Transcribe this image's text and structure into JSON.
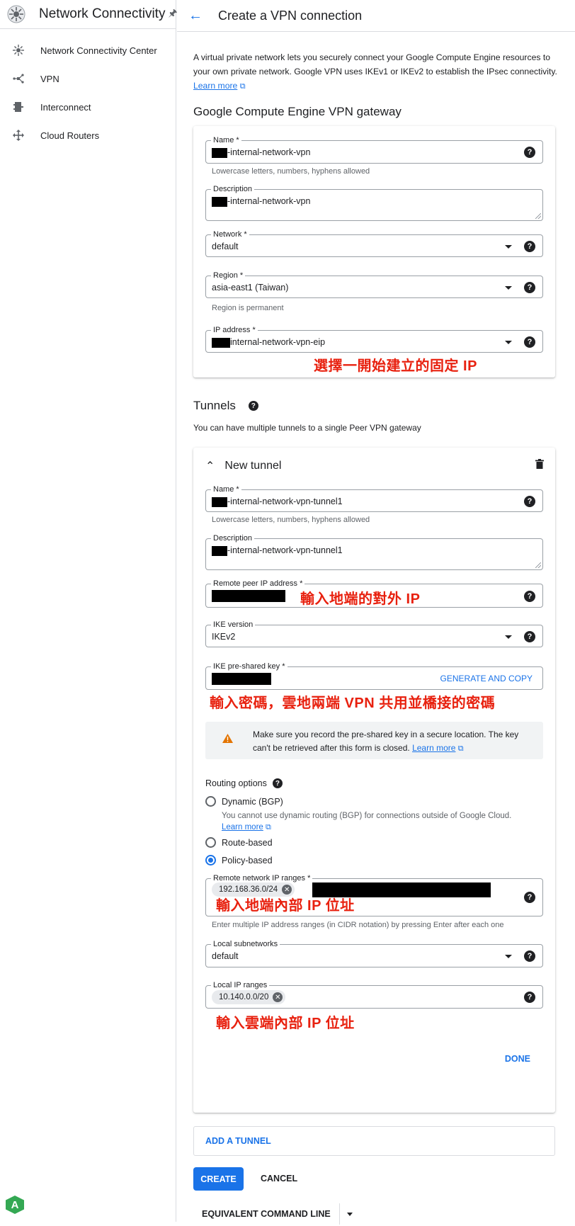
{
  "sidebar": {
    "title": "Network Connectivity",
    "items": [
      {
        "label": "Network Connectivity Center",
        "icon": "hub-icon"
      },
      {
        "label": "VPN",
        "icon": "vpn-icon"
      },
      {
        "label": "Interconnect",
        "icon": "interconnect-icon"
      },
      {
        "label": "Cloud Routers",
        "icon": "router-icon"
      }
    ],
    "avatar_letter": "A"
  },
  "header": {
    "title": "Create a VPN connection"
  },
  "intro": {
    "text": "A virtual private network lets you securely connect your Google Compute Engine resources to your own private network. Google VPN uses IKEv1 or IKEv2 to establish the IPsec connectivity. ",
    "link": "Learn more"
  },
  "gateway": {
    "heading": "Google Compute Engine VPN gateway",
    "name": {
      "label": "Name *",
      "value": "-internal-network-vpn",
      "hint": "Lowercase letters, numbers, hyphens allowed"
    },
    "description": {
      "label": "Description",
      "value": "-internal-network-vpn"
    },
    "network": {
      "label": "Network *",
      "value": "default"
    },
    "region": {
      "label": "Region *",
      "value": "asia-east1 (Taiwan)",
      "hint": "Region is permanent"
    },
    "ip_address": {
      "label": "IP address *",
      "value": "internal-network-vpn-eip"
    },
    "annotation": "選擇一開始建立的固定 IP"
  },
  "tunnels": {
    "heading": "Tunnels",
    "subtext": "You can have multiple tunnels to a single Peer VPN gateway",
    "tunnel_title": "New tunnel",
    "name": {
      "label": "Name *",
      "value": "-internal-network-vpn-tunnel1",
      "hint": "Lowercase letters, numbers, hyphens allowed"
    },
    "description": {
      "label": "Description",
      "value": "-internal-network-vpn-tunnel1"
    },
    "remote_peer": {
      "label": "Remote peer IP address *",
      "annotation": "輸入地端的對外 IP"
    },
    "ike_version": {
      "label": "IKE version",
      "value": "IKEv2"
    },
    "psk": {
      "label": "IKE pre-shared key *",
      "generate": "GENERATE AND COPY",
      "annotation": "輸入密碼，雲地兩端 VPN 共用並橋接的密碼"
    },
    "warning": {
      "text": "Make sure you record the pre-shared key in a secure location. The key can't be retrieved after this form is closed. ",
      "link": "Learn more"
    },
    "routing": {
      "label": "Routing options",
      "dynamic": "Dynamic (BGP)",
      "dynamic_note": "You cannot use dynamic routing (BGP) for connections outside of Google Cloud.",
      "dynamic_link": "Learn more",
      "route_based": "Route-based",
      "policy_based": "Policy-based",
      "selected": "Policy-based"
    },
    "remote_ranges": {
      "label": "Remote network IP ranges *",
      "chip": "192.168.36.0/24",
      "annotation": "輸入地端內部 IP 位址",
      "hint": "Enter multiple IP address ranges (in CIDR notation) by pressing Enter after each one"
    },
    "local_subnets": {
      "label": "Local subnetworks",
      "value": "default"
    },
    "local_ranges": {
      "label": "Local IP ranges",
      "chip": "10.140.0.0/20",
      "annotation": "輸入雲端內部 IP 位址"
    },
    "done": "DONE"
  },
  "actions": {
    "add_tunnel": "ADD A TUNNEL",
    "create": "CREATE",
    "cancel": "CANCEL",
    "equivalent": "EQUIVALENT COMMAND LINE"
  },
  "colors": {
    "accent": "#1a73e8",
    "annotation": "#e8210f",
    "warning": "#e37400",
    "avatar": "#34a853"
  }
}
